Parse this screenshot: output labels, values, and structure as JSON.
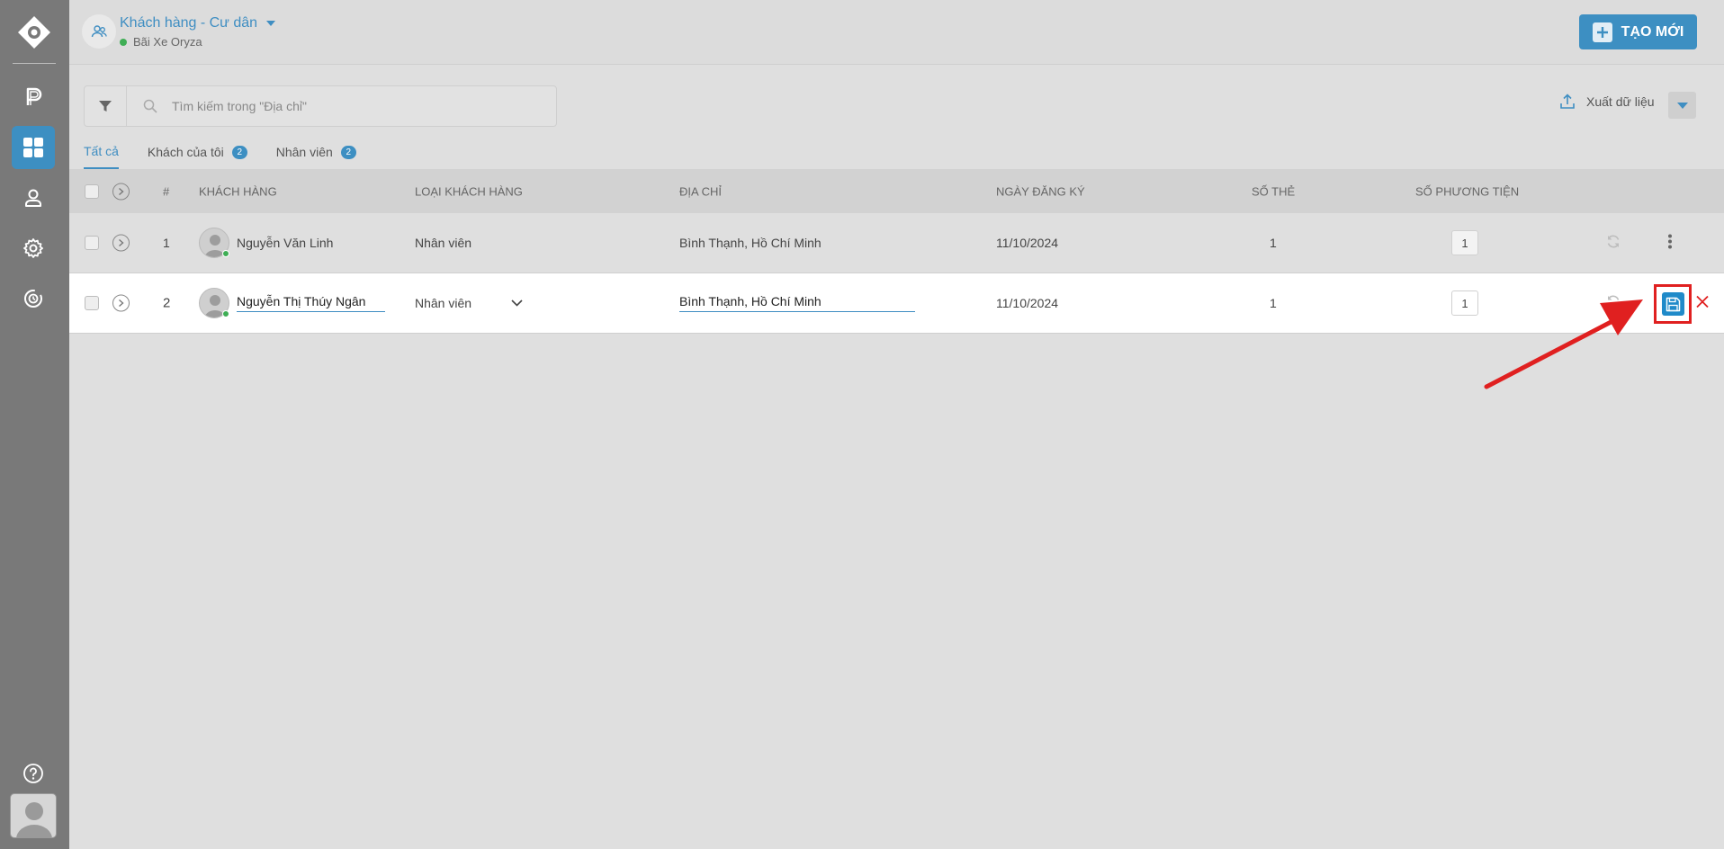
{
  "header": {
    "title": "Khách hàng - Cư dân",
    "subtitle": "Bãi Xe Oryza",
    "new_button": "TẠO MỚI"
  },
  "toolbar": {
    "search_placeholder": "Tìm kiếm trong \"Địa chỉ\"",
    "export_label": "Xuất dữ liệu"
  },
  "tabs": [
    {
      "label": "Tất cả",
      "badge": null
    },
    {
      "label": "Khách của tôi",
      "badge": "2"
    },
    {
      "label": "Nhân viên",
      "badge": "2"
    }
  ],
  "table": {
    "columns": {
      "index": "#",
      "customer": "KHÁCH HÀNG",
      "type": "LOẠI KHÁCH HÀNG",
      "address": "ĐỊA CHỈ",
      "reg_date": "NGÀY ĐĂNG KÝ",
      "cards": "SỐ THẺ",
      "vehicles": "SỐ PHƯƠNG TIỆN"
    },
    "rows": [
      {
        "index": "1",
        "name": "Nguyễn Văn Linh",
        "type": "Nhân viên",
        "address": "Bình Thạnh, Hồ Chí Minh",
        "reg_date": "11/10/2024",
        "cards": "1",
        "vehicles": "1"
      },
      {
        "index": "2",
        "name": "Nguyễn Thị Thúy Ngân",
        "type": "Nhân viên",
        "address": "Bình Thạnh, Hồ Chí Minh",
        "reg_date": "11/10/2024",
        "cards": "1",
        "vehicles": "1"
      }
    ]
  },
  "colors": {
    "accent": "#3d8fc2",
    "sidebar": "#797979",
    "highlight": "#e02020",
    "online": "#3fae55"
  }
}
